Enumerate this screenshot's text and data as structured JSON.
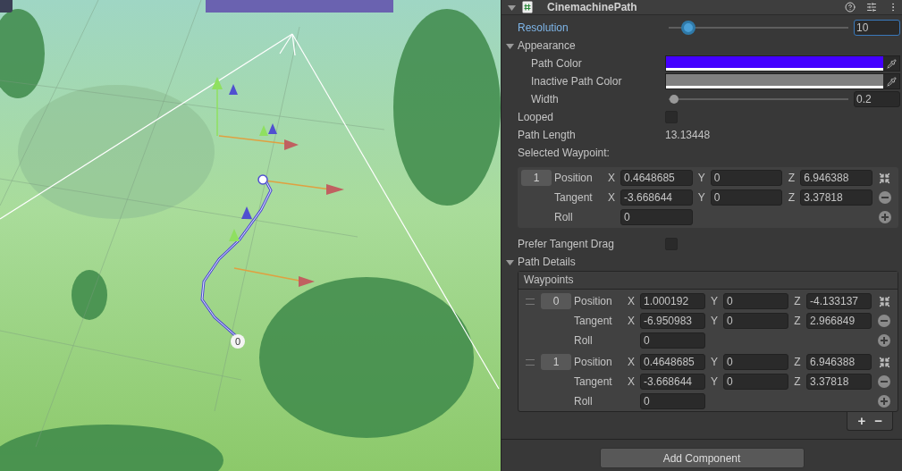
{
  "scene": {
    "waypoint_label": "0"
  },
  "component": {
    "title": "CinemachinePath",
    "expanded": true
  },
  "resolution": {
    "label": "Resolution",
    "level": 0.11,
    "value": "10",
    "focused": true
  },
  "appearance": {
    "label": "Appearance",
    "expanded": true,
    "colors": [
      {
        "label": "Path Color",
        "color": "#4400ff"
      },
      {
        "label": "Inactive Path Color",
        "color": "#808080"
      }
    ],
    "width": {
      "label": "Width",
      "level": 0.03,
      "value": "0.2"
    }
  },
  "looped": {
    "label": "Looped",
    "checked": false
  },
  "path_length": {
    "label": "Path Length",
    "value": "13.13448"
  },
  "selected_waypoint": {
    "label": "Selected Waypoint:",
    "index": "1",
    "rows": [
      {
        "kind": "vector",
        "label": "Position",
        "components": [
          {
            "axis": "X",
            "value": "0.4648685"
          },
          {
            "axis": "Y",
            "value": "0"
          },
          {
            "axis": "Z",
            "value": "6.946388"
          }
        ]
      },
      {
        "kind": "vector",
        "label": "Tangent",
        "components": [
          {
            "axis": "X",
            "value": "-3.668644"
          },
          {
            "axis": "Y",
            "value": "0"
          },
          {
            "axis": "Z",
            "value": "3.37818"
          }
        ]
      },
      {
        "kind": "scalar",
        "label": "Roll",
        "value": "0"
      }
    ]
  },
  "prefer_tangent_drag": {
    "label": "Prefer Tangent Drag",
    "checked": false
  },
  "path_details": {
    "label": "Path Details",
    "expanded": true,
    "waypoints": {
      "title": "Waypoints",
      "items": [
        {
          "index": "0",
          "rows": [
            {
              "kind": "vector",
              "label": "Position",
              "components": [
                {
                  "axis": "X",
                  "value": "1.000192"
                },
                {
                  "axis": "Y",
                  "value": "0"
                },
                {
                  "axis": "Z",
                  "value": "-4.133137"
                }
              ]
            },
            {
              "kind": "vector",
              "label": "Tangent",
              "components": [
                {
                  "axis": "X",
                  "value": "-6.950983"
                },
                {
                  "axis": "Y",
                  "value": "0"
                },
                {
                  "axis": "Z",
                  "value": "2.966849"
                }
              ]
            },
            {
              "kind": "scalar",
              "label": "Roll",
              "value": "0"
            }
          ]
        },
        {
          "index": "1",
          "rows": [
            {
              "kind": "vector",
              "label": "Position",
              "components": [
                {
                  "axis": "X",
                  "value": "0.4648685"
                },
                {
                  "axis": "Y",
                  "value": "0"
                },
                {
                  "axis": "Z",
                  "value": "6.946388"
                }
              ]
            },
            {
              "kind": "vector",
              "label": "Tangent",
              "components": [
                {
                  "axis": "X",
                  "value": "-3.668644"
                },
                {
                  "axis": "Y",
                  "value": "0"
                },
                {
                  "axis": "Z",
                  "value": "3.37818"
                }
              ]
            },
            {
              "kind": "scalar",
              "label": "Roll",
              "value": "0"
            }
          ]
        }
      ],
      "buttons": [
        "+",
        "−"
      ]
    }
  },
  "add_component": "Add Component"
}
